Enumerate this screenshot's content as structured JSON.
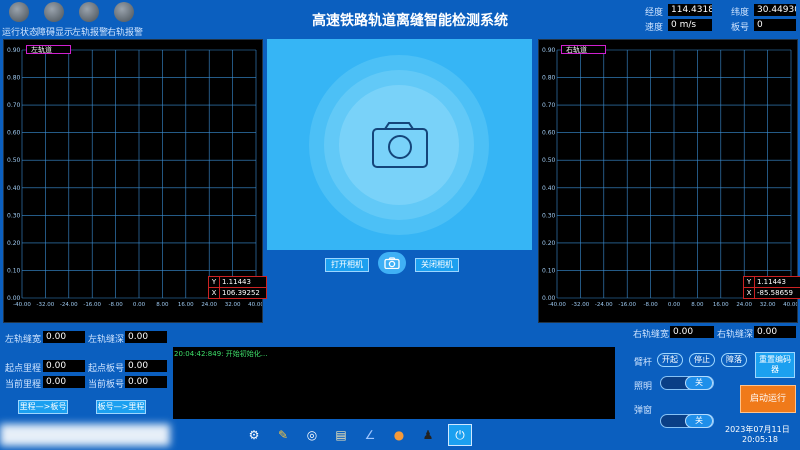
{
  "status_lamps": [
    {
      "label": "运行状态"
    },
    {
      "label": "障碍显示"
    },
    {
      "label": "左轨报警"
    },
    {
      "label": "右轨报警"
    }
  ],
  "app_title": "高速铁路轨道离缝智能检测系统",
  "gps": {
    "longitude_label": "经度",
    "longitude": "114.43180",
    "latitude_label": "纬度",
    "latitude": "30.44930",
    "speed_label": "速度",
    "speed": "0 m/s",
    "board_label": "板号",
    "board": "0"
  },
  "left_chart": {
    "legend": "左轨道",
    "y_value": "1.11443",
    "x_value": "106.39252"
  },
  "right_chart": {
    "legend": "右轨道",
    "y_value": "1.11443",
    "x_value": "-85.58659"
  },
  "chart_data": [
    {
      "type": "line",
      "legend": "左轨道",
      "y_ticks": [
        "0.90",
        "0.80",
        "0.70",
        "0.60",
        "0.50",
        "0.40",
        "0.30",
        "0.20",
        "0.10",
        "0.00"
      ],
      "x_ticks": [
        "-40.00",
        "-32.00",
        "-24.00",
        "-16.00",
        "-8.00",
        "0.00",
        "8.00",
        "16.00",
        "24.00",
        "32.00",
        "40.00"
      ],
      "xlim": [
        -40,
        40
      ],
      "ylim": [
        0,
        0.9
      ],
      "grid": true,
      "series": []
    },
    {
      "type": "line",
      "legend": "右轨道",
      "y_ticks": [
        "0.90",
        "0.80",
        "0.70",
        "0.60",
        "0.50",
        "0.40",
        "0.30",
        "0.20",
        "0.10",
        "0.00"
      ],
      "x_ticks": [
        "-40.00",
        "-32.00",
        "-24.00",
        "-16.00",
        "-8.00",
        "0.00",
        "8.00",
        "16.00",
        "24.00",
        "32.00",
        "40.00"
      ],
      "xlim": [
        -40,
        40
      ],
      "ylim": [
        0,
        0.9
      ],
      "grid": true,
      "series": []
    }
  ],
  "camera": {
    "open_label": "打开相机",
    "close_label": "关闭相机"
  },
  "left_measure": {
    "gap_width_label": "左轨缝宽",
    "gap_width": "0.00",
    "gap_depth_label": "左轨缝深",
    "gap_depth": "0.00",
    "start_mileage_label": "起点里程",
    "start_mileage": "0.00",
    "start_board_label": "起点板号",
    "start_board": "0.00",
    "current_mileage_label": "当前里程",
    "current_mileage": "0.00",
    "current_board_label": "当前板号",
    "current_board": "0.00",
    "mileage_to_board": "里程—>板号",
    "board_to_mileage": "板号—>里程"
  },
  "right_measure": {
    "gap_width_label": "右轨缝宽",
    "gap_width": "0.00",
    "gap_depth_label": "右轨缝深",
    "gap_depth": "0.00"
  },
  "log": {
    "line1": "20:04:42:849: 开始初始化..."
  },
  "controls": {
    "arm_label": "臂杆",
    "open_btn": "开起",
    "stop_btn": "停止",
    "fault_btn": "障落",
    "light_label": "照明",
    "light_state": "关",
    "window_label": "弹窗",
    "window_state": "关",
    "reset_encoder": "重置编码器",
    "start_run": "启动运行"
  },
  "datetime": {
    "date": "2023年07月11日",
    "time": "20:05:18"
  },
  "colors": {
    "background": "#0b5fbf",
    "start_button": "#f07a1a",
    "grid": "#3b8fd6"
  }
}
